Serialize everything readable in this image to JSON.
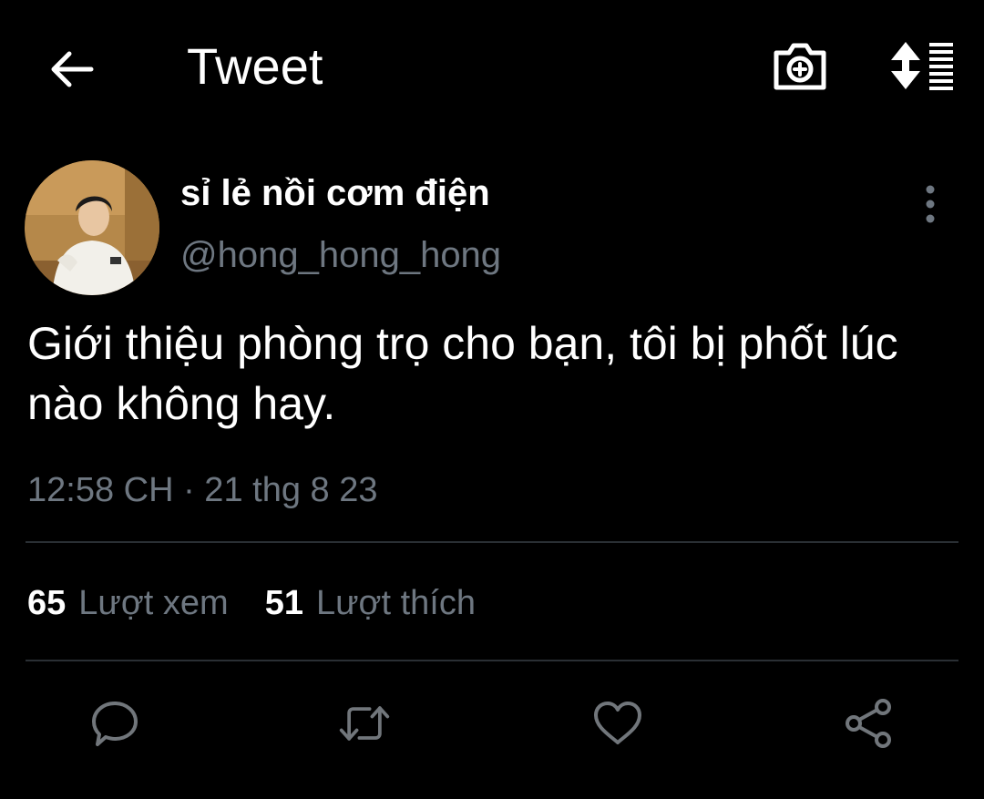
{
  "header": {
    "title": "Tweet",
    "back_icon": "arrow-left-icon",
    "camera_icon": "camera-plus-icon",
    "sort_icon": "sort-list-icon"
  },
  "author": {
    "display_name": "sỉ lẻ nồi cơm điện",
    "handle": "@hong_hong_hong",
    "more_icon": "more-vertical-icon"
  },
  "tweet": {
    "text": "Giới thiệu phòng trọ cho bạn, tôi bị phốt lúc nào không hay.",
    "timestamp": "12:58 CH · 21 thg 8 23"
  },
  "stats": {
    "views_count": "65",
    "views_label": "Lượt xem",
    "likes_count": "51",
    "likes_label": "Lượt thích"
  },
  "actions": [
    {
      "icon": "reply-icon"
    },
    {
      "icon": "retweet-icon"
    },
    {
      "icon": "heart-icon"
    },
    {
      "icon": "share-icon"
    }
  ],
  "colors": {
    "background": "#000000",
    "text_primary": "#ffffff",
    "text_secondary": "#6e7781",
    "divider": "#2a2f34",
    "icon_muted": "#71767b"
  }
}
